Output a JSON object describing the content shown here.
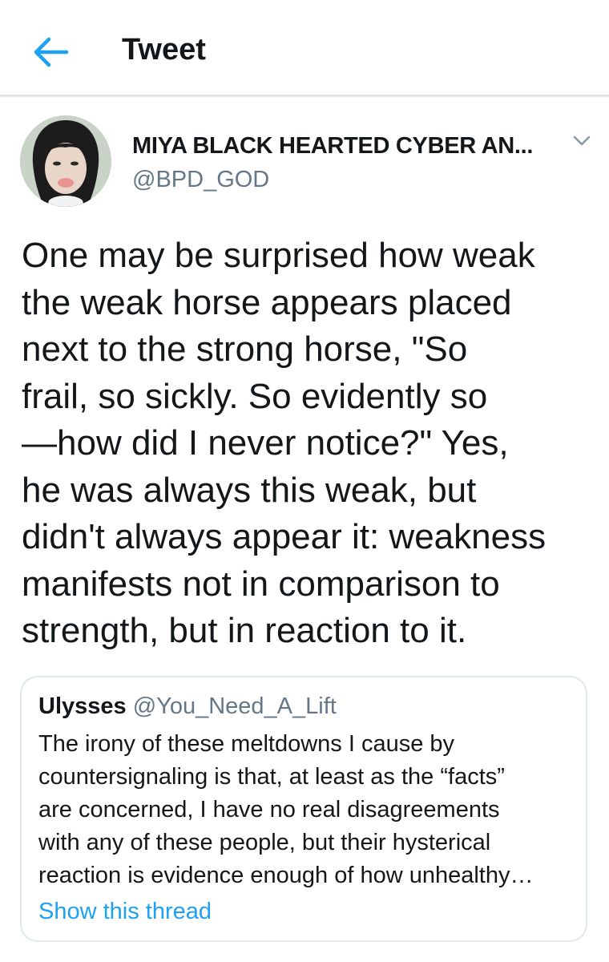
{
  "header": {
    "title": "Tweet",
    "back_icon": "arrow-left-icon",
    "accent_color": "#1da1f2"
  },
  "tweet": {
    "author": {
      "name": "MIYA BLACK HEARTED CYBER AN...",
      "handle": "@BPD_GOD"
    },
    "text_lines": [
      "One may be surprised how weak",
      "the weak horse appears placed",
      "next to the strong horse, \"So",
      "frail, so sickly. So evidently so",
      "—how did I never notice?\" Yes,",
      "he was always this weak, but",
      "didn't always appear it: weakness",
      "manifests not in comparison to",
      "strength, but in reaction to it."
    ],
    "menu_icon": "chevron-down-icon"
  },
  "quoted_tweet": {
    "name": "Ulysses",
    "handle": "@You_Need_A_Lift",
    "text_lines": [
      "The irony of these meltdowns I cause by",
      "countersignaling is that, at least as the “facts”",
      "are concerned, I have no real disagreements",
      "with any of these people, but their hysterical",
      "reaction is evidence enough of how unhealthy…"
    ],
    "show_thread": "Show this thread"
  }
}
